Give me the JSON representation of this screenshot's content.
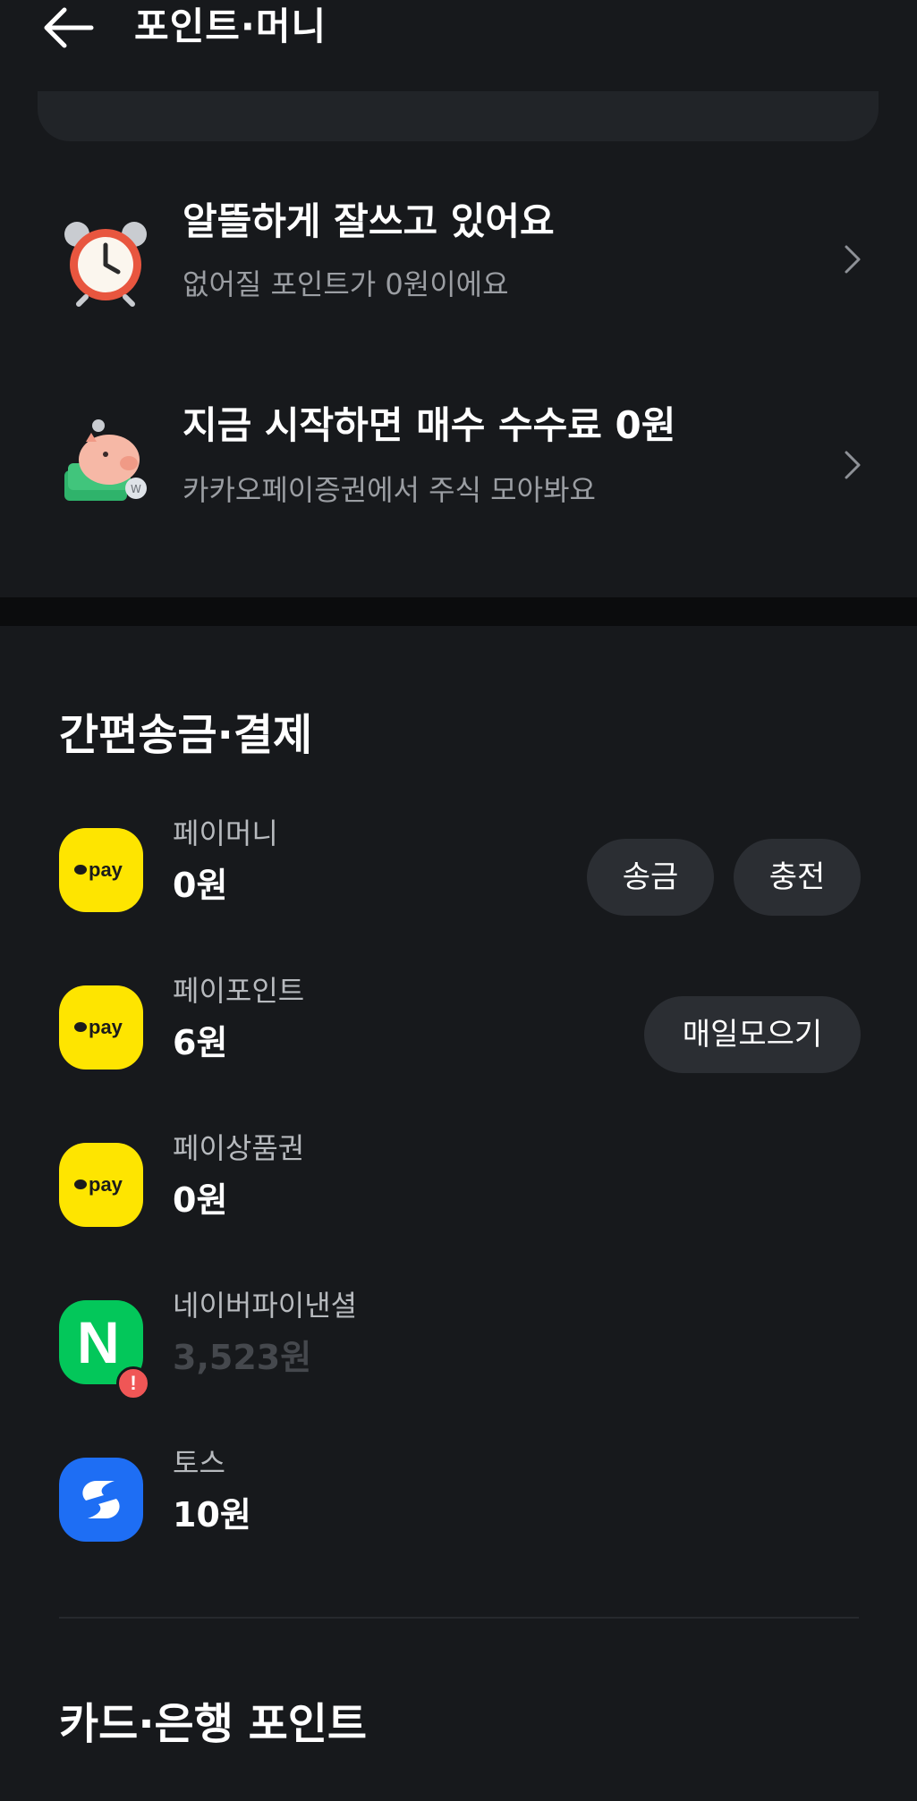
{
  "header": {
    "title": "포인트·머니"
  },
  "promos": [
    {
      "title": "알뜰하게 잘쓰고 있어요",
      "subtitle": "없어질 포인트가 0원이에요",
      "icon": "alarm-clock-icon"
    },
    {
      "title": "지금 시작하면 매수 수수료 0원",
      "subtitle": "카카오페이증권에서 주식 모아봐요",
      "icon": "piggy-bank-icon"
    }
  ],
  "easy_pay": {
    "title": "간편송금·결제",
    "items": [
      {
        "name": "페이머니",
        "amount": "0원",
        "logo": "kakaopay",
        "logo_text": "pay",
        "buttons": [
          "송금",
          "충전"
        ]
      },
      {
        "name": "페이포인트",
        "amount": "6원",
        "logo": "kakaopay",
        "logo_text": "pay",
        "buttons": [
          "매일모으기"
        ]
      },
      {
        "name": "페이상품권",
        "amount": "0원",
        "logo": "kakaopay",
        "logo_text": "pay",
        "buttons": []
      },
      {
        "name": "네이버파이낸셜",
        "amount": "3,523원",
        "logo": "naver",
        "logo_text": "N",
        "badge": "!",
        "buttons": []
      },
      {
        "name": "토스",
        "amount": "10원",
        "logo": "toss",
        "buttons": []
      }
    ]
  },
  "card_bank": {
    "title": "카드·은행 포인트"
  },
  "colors": {
    "background": "#17191c",
    "kakao_yellow": "#fee500",
    "naver_green": "#03c75a",
    "toss_blue": "#1e6ef4",
    "alert_red": "#f05656"
  }
}
